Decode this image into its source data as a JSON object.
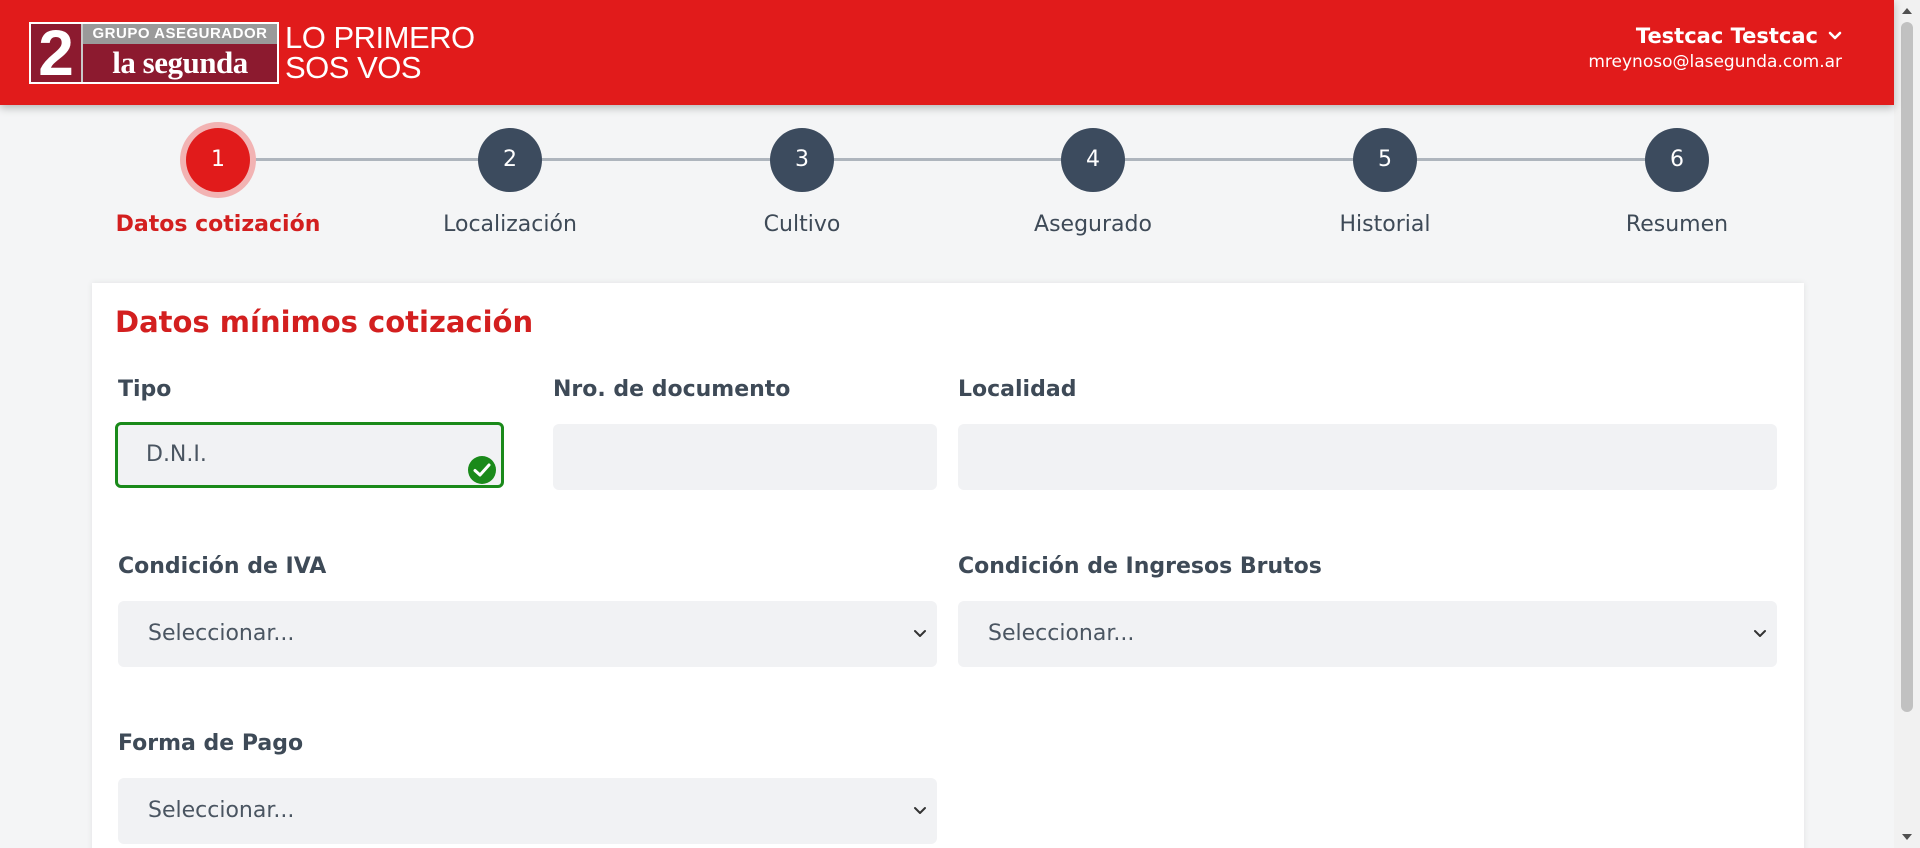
{
  "brand": {
    "logo_number": "2",
    "logo_top": "GRUPO ASEGURADOR",
    "logo_bottom": "la segunda",
    "tagline_line1": "LO PRIMERO",
    "tagline_line2": "SOS VOS",
    "header_color": "#e11b1b"
  },
  "user": {
    "name": "Testcac Testcac",
    "email": "mreynoso@lasegunda.com.ar",
    "menu_icon": "chevron-down-icon"
  },
  "stepper": {
    "steps": [
      {
        "number": "1",
        "label": "Datos cotización",
        "active": true
      },
      {
        "number": "2",
        "label": "Localización",
        "active": false
      },
      {
        "number": "3",
        "label": "Cultivo",
        "active": false
      },
      {
        "number": "4",
        "label": "Asegurado",
        "active": false
      },
      {
        "number": "5",
        "label": "Historial",
        "active": false
      },
      {
        "number": "6",
        "label": "Resumen",
        "active": false
      }
    ],
    "active_color": "#e11b1b",
    "inactive_color": "#3c4b5e"
  },
  "form": {
    "title": "Datos mínimos cotización",
    "tipo": {
      "label": "Tipo",
      "value": "D.N.I.",
      "status": "valid"
    },
    "nro_documento": {
      "label": "Nro. de documento",
      "value": ""
    },
    "localidad": {
      "label": "Localidad",
      "value": ""
    },
    "condicion_iva": {
      "label": "Condición de IVA",
      "value": "Seleccionar..."
    },
    "condicion_ingresos": {
      "label": "Condición de Ingresos Brutos",
      "value": "Seleccionar..."
    },
    "forma_pago": {
      "label": "Forma de Pago",
      "value": "Seleccionar..."
    }
  }
}
